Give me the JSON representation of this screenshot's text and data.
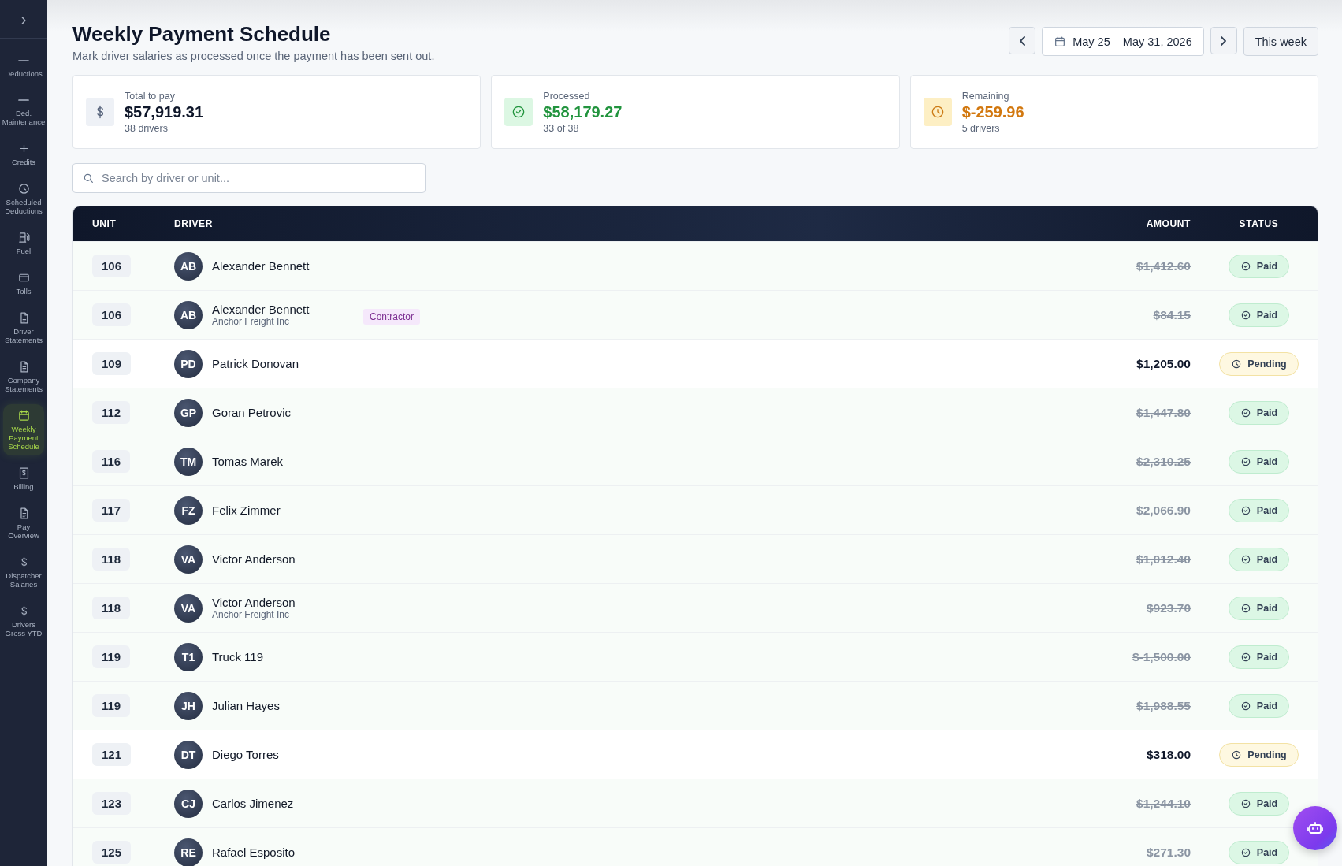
{
  "sidebar": {
    "toggle": "›",
    "items": [
      {
        "label": "Deductions",
        "selected": false
      },
      {
        "label": "Ded. Maintenance",
        "selected": false
      },
      {
        "label": "Credits",
        "selected": false
      },
      {
        "label": "Scheduled Deductions",
        "selected": false
      },
      {
        "label": "Fuel",
        "selected": false
      },
      {
        "label": "Tolls",
        "selected": false
      },
      {
        "label": "Driver Statements",
        "selected": false
      },
      {
        "label": "Company Statements",
        "selected": false
      },
      {
        "label": "Weekly Payment Schedule",
        "selected": true
      },
      {
        "label": "Billing",
        "selected": false
      },
      {
        "label": "Pay Overview",
        "selected": false
      },
      {
        "label": "Dispatcher Salaries",
        "selected": false
      },
      {
        "label": "Drivers Gross YTD",
        "selected": false
      }
    ]
  },
  "header": {
    "title": "Weekly Payment Schedule",
    "subtitle": "Mark driver salaries as processed once the payment has been sent out.",
    "date_range": "May 25 – May 31, 2026",
    "this_week": "This week"
  },
  "cards": [
    {
      "kind": "total",
      "label": "Total to pay",
      "value": "$57,919.31",
      "note": "38 drivers"
    },
    {
      "kind": "processed",
      "label": "Processed",
      "value": "$58,179.27",
      "note": "33 of 38"
    },
    {
      "kind": "remaining",
      "label": "Remaining",
      "value": "$-259.96",
      "note": "5 drivers"
    }
  ],
  "search": {
    "placeholder": "Search by driver or unit..."
  },
  "table": {
    "columns": [
      "UNIT",
      "DRIVER",
      "AMOUNT",
      "STATUS"
    ],
    "rows": [
      {
        "unit": "106",
        "initials": "AB",
        "driver": "Alexander Bennett",
        "amount": "$1,412.60",
        "paid": true,
        "status": "Paid"
      },
      {
        "unit": "106",
        "initials": "AB",
        "driver": "Alexander Bennett",
        "company": "Anchor Freight Inc",
        "tag": "Contractor",
        "amount": "$84.15",
        "paid": true,
        "status": "Paid"
      },
      {
        "unit": "109",
        "initials": "PD",
        "driver": "Patrick Donovan",
        "amount": "$1,205.00",
        "paid": false,
        "status": "Pending"
      },
      {
        "unit": "112",
        "initials": "GP",
        "driver": "Goran Petrovic",
        "amount": "$1,447.80",
        "paid": true,
        "status": "Paid"
      },
      {
        "unit": "116",
        "initials": "TM",
        "driver": "Tomas Marek",
        "amount": "$2,310.25",
        "paid": true,
        "status": "Paid"
      },
      {
        "unit": "117",
        "initials": "FZ",
        "driver": "Felix Zimmer",
        "amount": "$2,066.90",
        "paid": true,
        "status": "Paid"
      },
      {
        "unit": "118",
        "initials": "VA",
        "driver": "Victor Anderson",
        "amount": "$1,012.40",
        "paid": true,
        "status": "Paid"
      },
      {
        "unit": "118",
        "initials": "VA",
        "driver": "Victor Anderson",
        "company": "Anchor Freight Inc",
        "amount": "$923.70",
        "paid": true,
        "status": "Paid"
      },
      {
        "unit": "119",
        "initials": "T1",
        "driver": "Truck 119",
        "amount": "$-1,500.00",
        "paid": true,
        "status": "Paid"
      },
      {
        "unit": "119",
        "initials": "JH",
        "driver": "Julian Hayes",
        "amount": "$1,988.55",
        "paid": true,
        "status": "Paid"
      },
      {
        "unit": "121",
        "initials": "DT",
        "driver": "Diego Torres",
        "amount": "$318.00",
        "paid": false,
        "status": "Pending"
      },
      {
        "unit": "123",
        "initials": "CJ",
        "driver": "Carlos Jimenez",
        "amount": "$1,244.10",
        "paid": true,
        "status": "Paid"
      },
      {
        "unit": "125",
        "initials": "RE",
        "driver": "Rafael Esposito",
        "amount": "$271.30",
        "paid": true,
        "status": "Paid"
      }
    ]
  }
}
